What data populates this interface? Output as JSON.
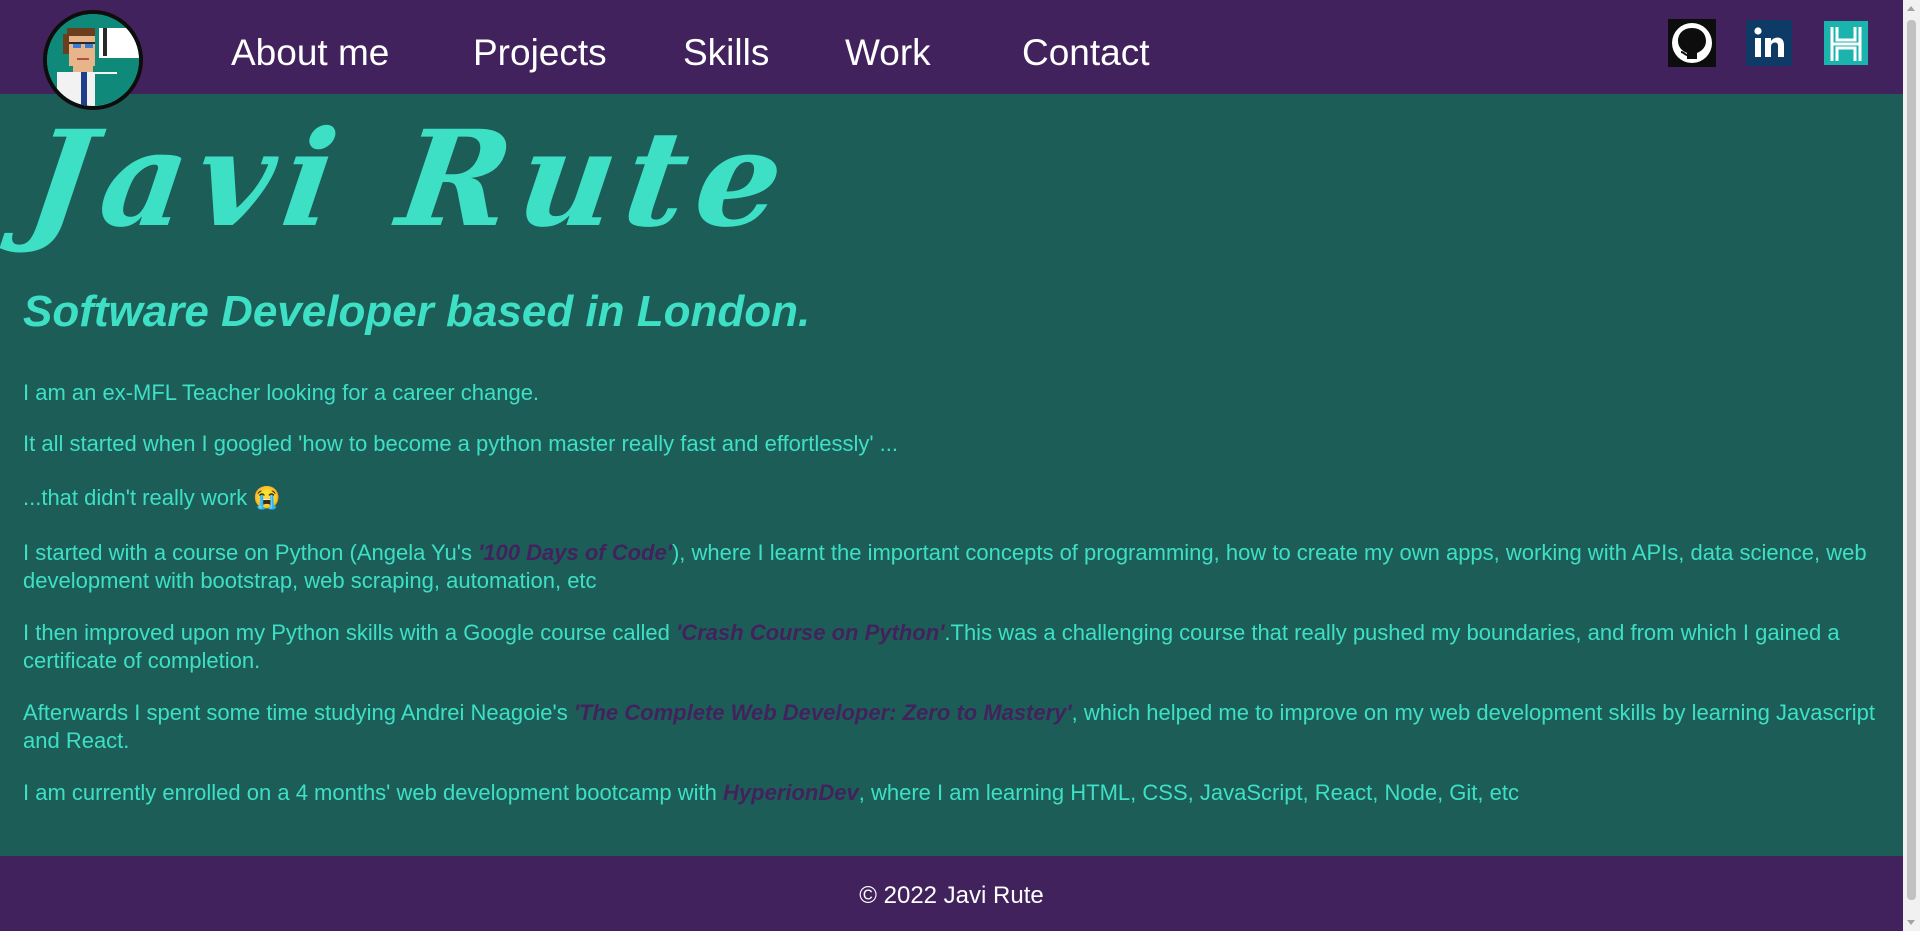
{
  "nav": {
    "links": [
      "About me",
      "Projects",
      "Skills",
      "Work",
      "Contact"
    ],
    "social": [
      {
        "icon": "github-icon"
      },
      {
        "icon": "linkedin-icon"
      },
      {
        "icon": "hyperiondev-icon"
      }
    ]
  },
  "hero": {
    "name": "Javi Rute",
    "subtitle": "Software Developer based in London."
  },
  "about": {
    "p1": "I am an ex-MFL Teacher looking for a career change.",
    "p2": "It all started when I googled 'how to become a python master really fast and effortlessly' ...",
    "p3_text": "...that didn't really work",
    "p3_emoji": "😭",
    "p4_before": "I started with a course on Python (Angela Yu's ",
    "p4_highlight": "'100 Days of Code'",
    "p4_after": "), where I learnt the important concepts of programming, how to create my own apps, working with APIs, data science, web development with bootstrap, web scraping, automation, etc",
    "p5_before": "I then improved upon my Python skills with a Google course called ",
    "p5_highlight": "'Crash Course on Python'",
    "p5_after": ".This was a challenging course that really pushed my boundaries, and from which I gained a certificate of completion.",
    "p6_before": "Afterwards I spent some time studying Andrei Neagoie's ",
    "p6_highlight": "'The Complete Web Developer: Zero to Mastery'",
    "p6_after": ", which helped me to improve on my web development skills by learning Javascript and React.",
    "p7_before": "I am currently enrolled on a 4 months' web development bootcamp with ",
    "p7_highlight": "HyperionDev",
    "p7_after": ", where I am learning HTML, CSS, JavaScript, React, Node, Git, etc"
  },
  "footer": {
    "text": "© 2022 Javi Rute"
  },
  "colors": {
    "nav_bg": "#42225c",
    "main_bg": "#1d5d58",
    "accent": "#3ee0c5",
    "highlight": "#42225c"
  }
}
